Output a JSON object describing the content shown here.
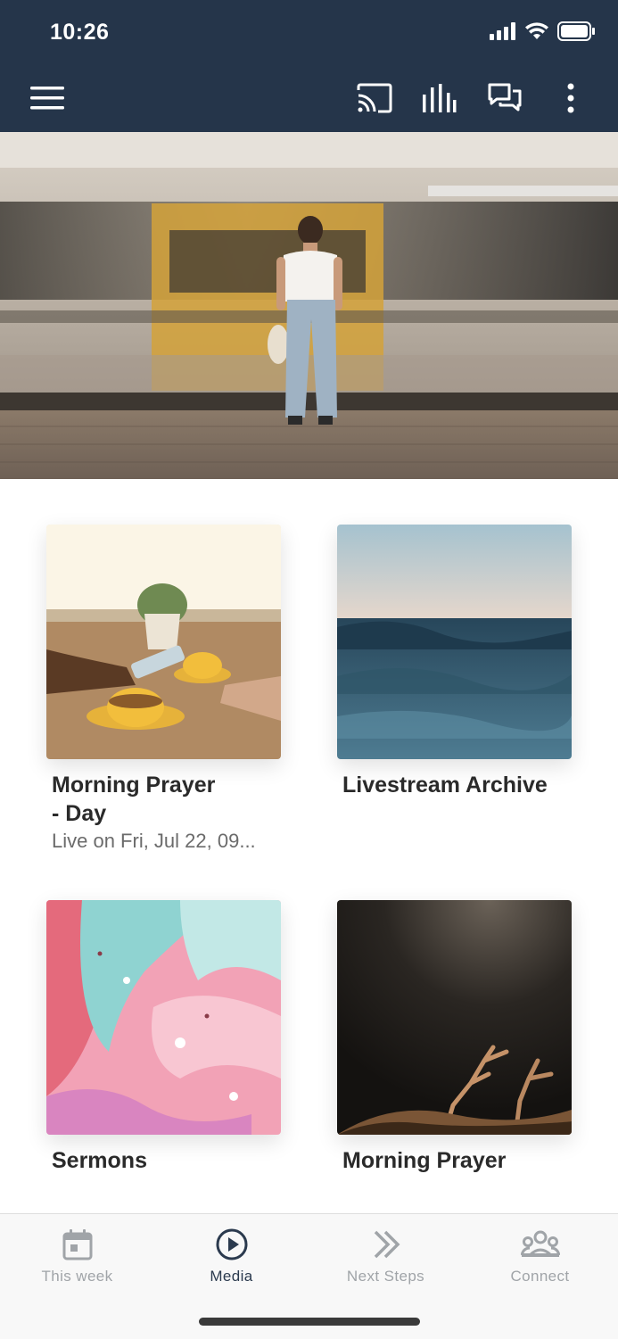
{
  "status_bar": {
    "time": "10:26"
  },
  "toolbar": {
    "menu_icon": "hamburger-icon",
    "cast_icon": "cast-icon",
    "audio_icon": "audio-bars-icon",
    "chat_icon": "chat-icon",
    "more_icon": "more-vertical-icon"
  },
  "hero": {
    "image": "woman-at-train-platform"
  },
  "cards": [
    {
      "title": "Morning Prayer\n- Day",
      "subtitle": "Live on Fri, Jul 22, 09...",
      "image": "coffee-phones"
    },
    {
      "title": "Livestream Archive",
      "subtitle": "",
      "image": "ocean-wave"
    },
    {
      "title": "Sermons",
      "subtitle": "",
      "image": "pink-fluid-art"
    },
    {
      "title": "Morning Prayer",
      "subtitle": "",
      "image": "worship-hands"
    }
  ],
  "tabs": [
    {
      "label": "This week",
      "icon": "calendar-icon",
      "active": false
    },
    {
      "label": "Media",
      "icon": "play-circle-icon",
      "active": true
    },
    {
      "label": "Next Steps",
      "icon": "double-chevron-icon",
      "active": false
    },
    {
      "label": "Connect",
      "icon": "group-icon",
      "active": false
    }
  ],
  "colors": {
    "topbar": "#25354a",
    "active_tab": "#2b3a4e",
    "inactive_tab": "#a0a4a8"
  }
}
